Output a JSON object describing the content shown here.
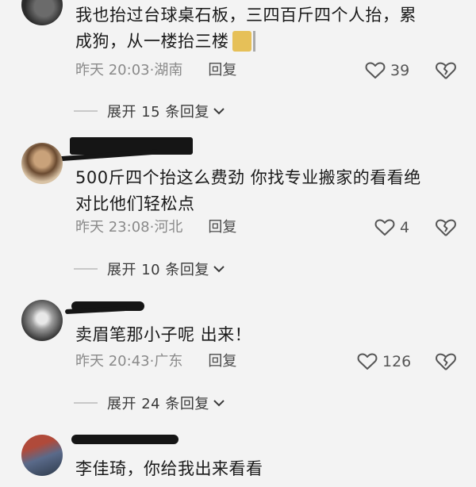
{
  "comments": [
    {
      "text_line1": "我也抬过台球桌石板，三四百斤四个人抬，累",
      "text_line2": "成狗，从一楼抬三楼",
      "time": "昨天 20:03",
      "location": "湖南",
      "reply": "回复",
      "likes": "39",
      "expand": "展开 15 条回复"
    },
    {
      "text_line1": "500斤四个抬这么费劲 你找专业搬家的看看绝",
      "text_line2": "对比他们轻松点",
      "time": "昨天 23:08",
      "location": "河北",
      "reply": "回复",
      "likes": "4",
      "expand": "展开 10 条回复"
    },
    {
      "text_line1": "卖眉笔那小子呢 出来！",
      "time": "昨天 20:43",
      "location": "广东",
      "reply": "回复",
      "likes": "126",
      "expand": "展开 24 条回复"
    },
    {
      "text_line1": "李佳琦，你给我出来看看"
    }
  ],
  "separator": "·",
  "icons": {
    "like": "heart-outline-icon",
    "dislike": "broken-heart-icon",
    "expand": "chevron-down-icon",
    "sticker": "emoji-sticker-icon"
  },
  "colors": {
    "background": "#f3f3f3",
    "text": "#1a1a1a",
    "meta": "#8a8a8a",
    "redaction": "#151515"
  }
}
